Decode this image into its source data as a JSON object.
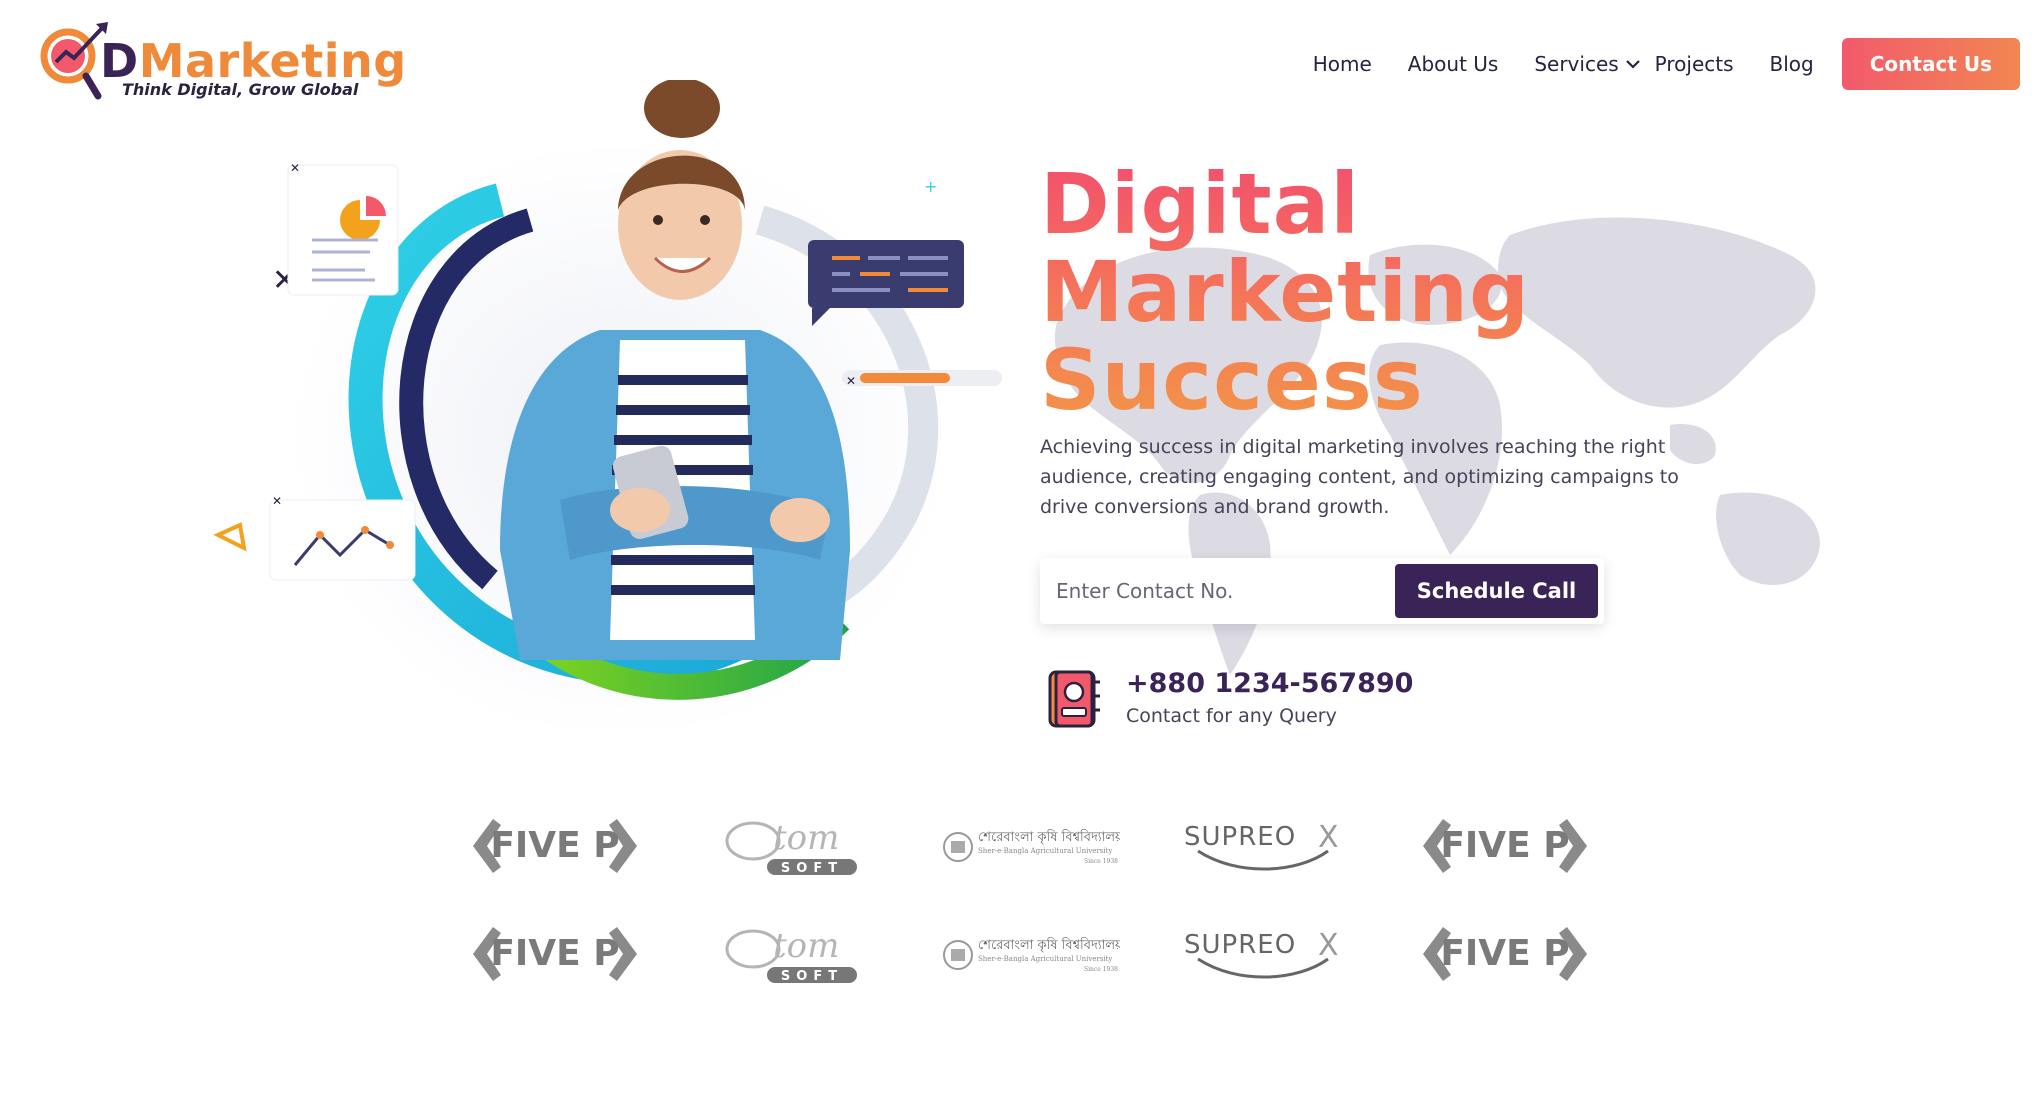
{
  "brand": {
    "name_initial": "D",
    "name_rest": "Marketing",
    "tagline": "Think Digital, Grow Global",
    "colors": {
      "primary": "#3a2356",
      "accent": "#ef8a3a",
      "pink": "#f25a6b"
    }
  },
  "nav": {
    "items": [
      {
        "label": "Home"
      },
      {
        "label": "About Us"
      },
      {
        "label": "Services",
        "icon": "chevron-down-icon"
      },
      {
        "label": "Projects"
      },
      {
        "label": "Blog"
      }
    ],
    "contact_label": "Contact Us"
  },
  "hero": {
    "title_lines": [
      "Digital",
      "Marketing",
      "Success"
    ],
    "description": "Achieving success in digital marketing involves reaching the right audience, creating engaging content, and optimizing campaigns to drive conversions and brand growth.",
    "form": {
      "placeholder": "Enter Contact No.",
      "button_label": "Schedule Call"
    },
    "phone": {
      "number": "+880 1234-567890",
      "caption": "Contact for any Query",
      "icon": "phone-book-icon"
    }
  },
  "clients": {
    "rows": [
      [
        "five-p-logo",
        "atom-soft-logo",
        "sau-logo",
        "supreox-logo",
        "five-p-logo"
      ],
      [
        "five-p-logo",
        "atom-soft-logo",
        "sau-logo",
        "supreox-logo",
        "five-p-logo"
      ]
    ],
    "five_p_text": "FIVE P",
    "atom_text": "tom",
    "soft_text": "SOFT",
    "supreox_text": "SUPREO",
    "supreox_x": "X",
    "sau_line1": "শেরেবাংলা কৃষি বিশ্ববিদ্যালয়",
    "sau_line2": "Sher-e-Bangla Agricultural University",
    "sau_line3": "Since 1938"
  }
}
